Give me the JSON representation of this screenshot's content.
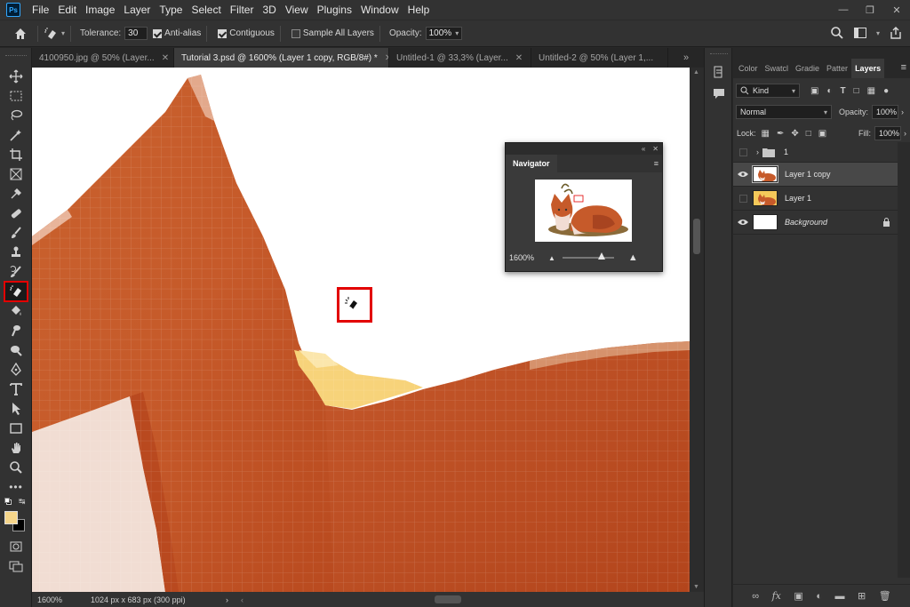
{
  "app": {
    "logo": "Ps",
    "menu": [
      "File",
      "Edit",
      "Image",
      "Layer",
      "Type",
      "Select",
      "Filter",
      "3D",
      "View",
      "Plugins",
      "Window",
      "Help"
    ]
  },
  "options_bar": {
    "tolerance_label": "Tolerance:",
    "tolerance_value": "30",
    "anti_alias_label": "Anti-alias",
    "anti_alias_checked": true,
    "contiguous_label": "Contiguous",
    "contiguous_checked": true,
    "sample_all_label": "Sample All Layers",
    "sample_all_checked": false,
    "opacity_label": "Opacity:",
    "opacity_value": "100%"
  },
  "tabs": [
    {
      "label": "4100950.jpg @ 50% (Layer...",
      "active": false
    },
    {
      "label": "Tutorial 3.psd @ 1600% (Layer 1 copy, RGB/8#) *",
      "active": true
    },
    {
      "label": "Untitled-1 @ 33,3% (Layer...",
      "active": false
    },
    {
      "label": "Untitled-2 @ 50% (Layer 1,...",
      "active": false
    }
  ],
  "status": {
    "zoom": "1600%",
    "doc_info": "1024 px x 683 px (300 ppi)"
  },
  "navigator": {
    "title": "Navigator",
    "zoom": "1600%"
  },
  "layers_panel": {
    "tabs": [
      "Color",
      "Swatcl",
      "Gradie",
      "Patter",
      "Layers"
    ],
    "active_tab": "Layers",
    "filter_kind": "Kind",
    "blend_mode": "Normal",
    "opacity_label": "Opacity:",
    "opacity_value": "100%",
    "lock_label": "Lock:",
    "fill_label": "Fill:",
    "fill_value": "100%",
    "group_name": "1",
    "layers": [
      {
        "name": "Layer 1 copy",
        "visible": true,
        "selected": true
      },
      {
        "name": "Layer 1",
        "visible": false,
        "selected": false
      },
      {
        "name": "Background",
        "visible": true,
        "selected": false,
        "locked": true
      }
    ]
  },
  "colors": {
    "accent_highlight": "#e20000",
    "foreground_swatch": "#f5d58a",
    "background_swatch": "#000000",
    "fox_orange": "#c45a2c",
    "fox_cream": "#f1ddd3",
    "yellow": "#f7d37a"
  }
}
